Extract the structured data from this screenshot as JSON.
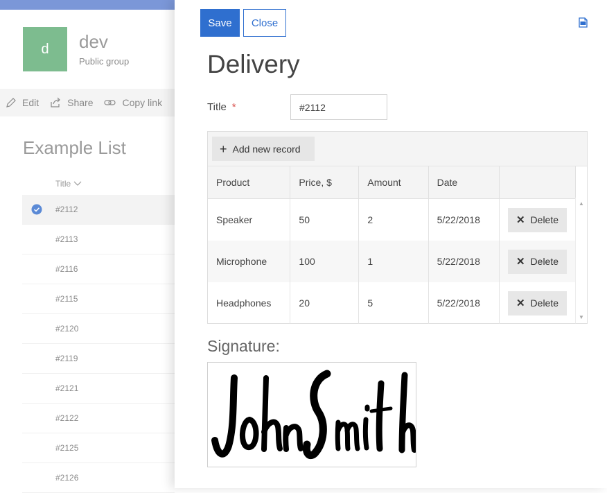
{
  "site": {
    "logo_letter": "d",
    "name": "dev",
    "subtitle": "Public group"
  },
  "commands": [
    {
      "label": "Edit",
      "icon": "pencil-icon"
    },
    {
      "label": "Share",
      "icon": "share-icon"
    },
    {
      "label": "Copy link",
      "icon": "link-icon"
    }
  ],
  "list": {
    "title": "Example List",
    "column_header": "Title",
    "rows": [
      "#2112",
      "#2113",
      "#2116",
      "#2115",
      "#2120",
      "#2119",
      "#2121",
      "#2122",
      "#2125",
      "#2126"
    ],
    "selected_index": 0
  },
  "panel": {
    "save_label": "Save",
    "close_label": "Close",
    "form_title": "Delivery",
    "title_field_label": "Title",
    "required_mark": "*",
    "title_value": "#2112",
    "add_record_label": "Add new record",
    "columns": [
      "Product",
      "Price, $",
      "Amount",
      "Date"
    ],
    "records": [
      {
        "product": "Speaker",
        "price": "50",
        "amount": "2",
        "date": "5/22/2018"
      },
      {
        "product": "Microphone",
        "price": "100",
        "amount": "1",
        "date": "5/22/2018"
      },
      {
        "product": "Headphones",
        "price": "20",
        "amount": "5",
        "date": "5/22/2018"
      }
    ],
    "delete_label": "Delete",
    "signature_label": "Signature:",
    "signature_text": "John Smith"
  },
  "colors": {
    "accent": "#2f6fcf",
    "logo_bg": "#7dbc8f",
    "top_bar": "#7b97d8"
  }
}
